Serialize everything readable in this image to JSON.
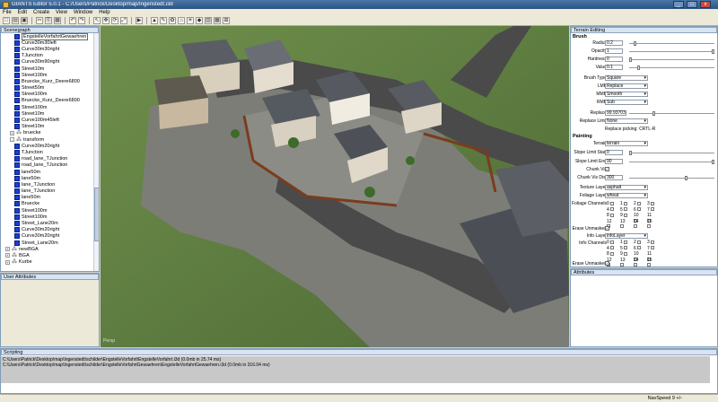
{
  "window": {
    "title": "GIANTS Editor 5.0.1 - C:/Users/Patrick/Desktop/map/Ingenstedt.i3d",
    "minimize": "_",
    "maximize": "□",
    "close": "x"
  },
  "menu": [
    "File",
    "Edit",
    "Create",
    "View",
    "Window",
    "Help"
  ],
  "toolbar": {
    "icons": [
      "new-icon",
      "open-icon",
      "save-icon",
      "cut-icon",
      "copy-icon",
      "paste-icon",
      "undo-icon",
      "redo-icon",
      "select-icon",
      "move-icon",
      "rotate-icon",
      "scale-icon",
      "play-icon",
      "terrain-icon",
      "paint-icon",
      "foliage-icon",
      "camera-icon",
      "light-icon",
      "shape-icon",
      "group-icon",
      "grid-icon",
      "snap-icon"
    ],
    "glyphs": [
      "□",
      "▤",
      "▣",
      "✂",
      "⎘",
      "▦",
      "↶",
      "↷",
      "↖",
      "✥",
      "⟳",
      "⤢",
      "▶",
      "▲",
      "✎",
      "✿",
      "⌂",
      "☀",
      "◆",
      "▥",
      "▦",
      "⊞"
    ]
  },
  "scenegraph": {
    "title": "Scenegraph",
    "items": [
      {
        "label": "EngstelleVorfahrtGewaehren",
        "kind": "cube",
        "indent": 3,
        "highlight": true
      },
      {
        "label": "Curve30m30left",
        "kind": "cube",
        "indent": 3
      },
      {
        "label": "Curve30m30right",
        "kind": "cube",
        "indent": 3
      },
      {
        "label": "TJunction",
        "kind": "cube",
        "indent": 3
      },
      {
        "label": "Curve30m90right",
        "kind": "cube",
        "indent": 3
      },
      {
        "label": "Street10m",
        "kind": "cube",
        "indent": 3
      },
      {
        "label": "Street100m",
        "kind": "cube",
        "indent": 3
      },
      {
        "label": "Bruecke_Kurz_Deere6800",
        "kind": "cube",
        "indent": 3
      },
      {
        "label": "Street50m",
        "kind": "cube",
        "indent": 3
      },
      {
        "label": "Street100m",
        "kind": "cube",
        "indent": 3
      },
      {
        "label": "Bruecke_Kurz_Deere6800",
        "kind": "cube",
        "indent": 3
      },
      {
        "label": "Street100m",
        "kind": "cube",
        "indent": 3
      },
      {
        "label": "Street10m",
        "kind": "cube",
        "indent": 3
      },
      {
        "label": "Curve100m45left",
        "kind": "cube",
        "indent": 3
      },
      {
        "label": "Street10m",
        "kind": "cube",
        "indent": 3
      },
      {
        "label": "bruecke",
        "kind": "group",
        "indent": 2,
        "expander": "+"
      },
      {
        "label": "transform",
        "kind": "group",
        "indent": 2,
        "expander": "-"
      },
      {
        "label": "Curve30m20right",
        "kind": "cube",
        "indent": 3
      },
      {
        "label": "TJunction",
        "kind": "cube",
        "indent": 3
      },
      {
        "label": "road_lane_TJunction",
        "kind": "cube",
        "indent": 3
      },
      {
        "label": "road_lane_TJunction",
        "kind": "cube",
        "indent": 3
      },
      {
        "label": "lane50m",
        "kind": "cube",
        "indent": 3
      },
      {
        "label": "lane50m",
        "kind": "cube",
        "indent": 3
      },
      {
        "label": "lane_TJunction",
        "kind": "cube",
        "indent": 3
      },
      {
        "label": "lane_TJunction",
        "kind": "cube",
        "indent": 3
      },
      {
        "label": "lane50m",
        "kind": "cube",
        "indent": 3
      },
      {
        "label": "Bruecke",
        "kind": "cube",
        "indent": 3
      },
      {
        "label": "Street100m",
        "kind": "cube",
        "indent": 3
      },
      {
        "label": "Street100m",
        "kind": "cube",
        "indent": 3
      },
      {
        "label": "Street_Lane20m",
        "kind": "cube",
        "indent": 3
      },
      {
        "label": "Curve30m20right",
        "kind": "cube",
        "indent": 3
      },
      {
        "label": "Curve30m20right",
        "kind": "cube",
        "indent": 3
      },
      {
        "label": "Street_Lane20m",
        "kind": "cube",
        "indent": 3
      },
      {
        "label": "newBGA",
        "kind": "group",
        "indent": 1,
        "expander": "+"
      },
      {
        "label": "BGA",
        "kind": "group",
        "indent": 1,
        "expander": "+"
      },
      {
        "label": "Kurbe",
        "kind": "group",
        "indent": 1,
        "expander": "+"
      }
    ]
  },
  "user_attributes": {
    "title": "User Attributes"
  },
  "viewport": {
    "label": "Persp"
  },
  "terrain_editing": {
    "title": "Terrain Editing",
    "brush_header": "Brush",
    "radius": {
      "label": "Radius",
      "value": "0.2",
      "level": 0.05
    },
    "opacity": {
      "label": "Opacity",
      "value": "1",
      "level": 1.0
    },
    "hardness": {
      "label": "Hardness",
      "value": "0",
      "level": 0.0
    },
    "value": {
      "label": "Value",
      "value": "0.1",
      "level": 0.1
    },
    "brush_type": {
      "label": "Brush Type",
      "value": "Square"
    },
    "lmb": {
      "label": "LMB",
      "value": "Replace"
    },
    "mmb": {
      "label": "MMB",
      "value": "Smooth"
    },
    "rmb": {
      "label": "RMB",
      "value": "Sub"
    },
    "replace": {
      "label": "Replace",
      "value": "99.93703"
    },
    "replace_limit": {
      "label": "Replace Limit",
      "value": "None"
    },
    "replace_picking": "Replace picking: CRTL-R",
    "painting_header": "Painting",
    "terrain": {
      "label": "Terrain",
      "value": "terrain"
    },
    "slope_limit_start": {
      "label": "Slope Limit Start",
      "value": "0"
    },
    "slope_limit_end": {
      "label": "Slope Limit End",
      "value": "90"
    },
    "chunk_vis": {
      "label": "Chunk Vis",
      "checked": "✓"
    },
    "chunk_vis_dist": {
      "label": "Chunk Vis Dist",
      "value": "300"
    },
    "texture_layer": {
      "label": "Texture Layer",
      "value": "asphalt"
    },
    "foliage_layer": {
      "label": "Foliage Layer",
      "value": "wheat"
    },
    "foliage_channels": {
      "label": "Foliage Channels",
      "numbers": [
        "0",
        "1",
        "2",
        "3",
        "4",
        "5",
        "6",
        "7",
        "8",
        "9",
        "10",
        "11",
        "12",
        "13",
        "14",
        "15"
      ]
    },
    "erase_unmasked_1": {
      "label": "Erase Unmasked",
      "checked": "✓"
    },
    "info_layer": {
      "label": "Info Layer",
      "value": "infoLayer"
    },
    "info_channels": {
      "label": "Info Channels",
      "numbers": [
        "0",
        "1",
        "2",
        "3",
        "4",
        "5",
        "6",
        "7",
        "8",
        "9",
        "10",
        "11",
        "12",
        "13",
        "14",
        "15"
      ]
    },
    "erase_unmasked_2": {
      "label": "Erase Unmasked",
      "checked": "✓"
    }
  },
  "attributes": {
    "title": "Attributes"
  },
  "scripting": {
    "title": "Scripting",
    "lines": [
      "C:\\Users\\Patrick\\Desktop\\map\\Ingenstedt\\schilder\\EngstelleVorfahrt\\EngstelleVorfahrt.i3d (0.0mb in 25.74 ms)",
      "C:\\Users\\Patrick\\Desktop\\map\\Ingenstedt\\schilder\\EngstelleVorfahrtGewaehren\\EngstelleVorfahrtGewaehren.i3d (0.0mb in 316.04 ms)"
    ]
  },
  "status": {
    "nav_speed": "NavSpeed 9 +/-"
  }
}
